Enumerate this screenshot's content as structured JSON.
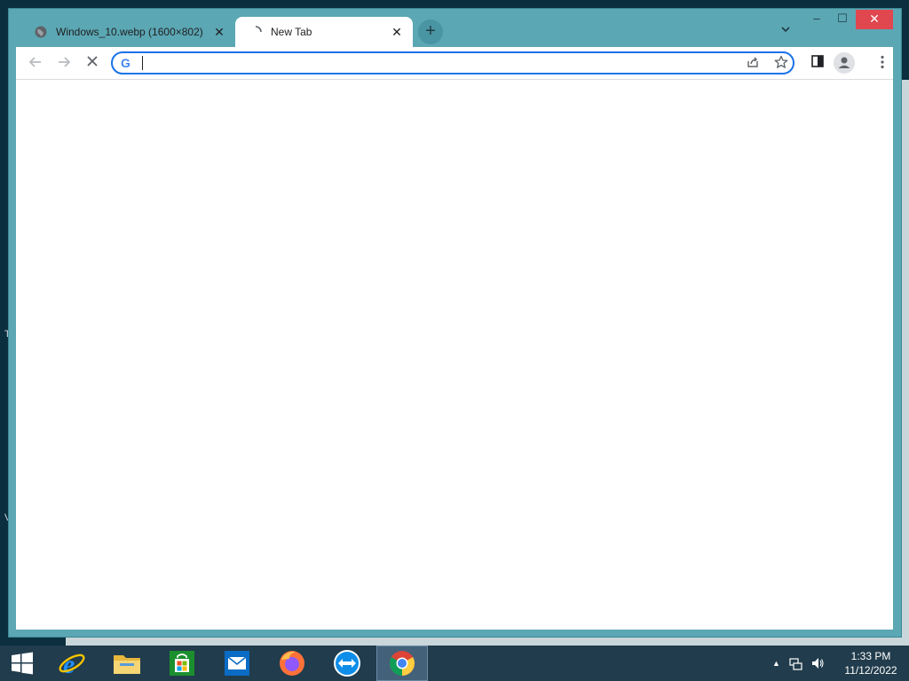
{
  "desktop": {
    "edge_letters": [
      "T",
      "V"
    ]
  },
  "browser": {
    "tabs": [
      {
        "title": "Windows_10.webp (1600×802)",
        "favicon": "globe-icon",
        "active": false
      },
      {
        "title": "New Tab",
        "favicon": "loading-spinner-icon",
        "active": true
      }
    ],
    "new_tab_glyph": "+",
    "tab_search_glyph": "⌄",
    "window_controls": {
      "minimize": "‒",
      "maximize": "☐",
      "close": "✕"
    },
    "toolbar": {
      "back_icon": "arrow-left-icon",
      "forward_icon": "arrow-right-icon",
      "stop_icon": "close-icon",
      "omnibox": {
        "value": "",
        "placeholder": "",
        "search_engine_icon": "google-g-icon"
      },
      "share_icon": "share-icon",
      "bookmark_icon": "star-icon",
      "side_panel_icon": "side-panel-icon",
      "profile_icon": "profile-avatar-icon",
      "menu_icon": "kebab-menu-icon"
    },
    "accent_color": "#1a73e8",
    "frame_color": "#5ba7b4"
  },
  "taskbar": {
    "apps": [
      {
        "name": "start",
        "icon": "windows-logo-icon"
      },
      {
        "name": "internet-explorer",
        "icon": "ie-icon"
      },
      {
        "name": "file-explorer",
        "icon": "folder-icon"
      },
      {
        "name": "store",
        "icon": "store-bag-icon"
      },
      {
        "name": "mail",
        "icon": "mail-icon"
      },
      {
        "name": "firefox",
        "icon": "firefox-icon"
      },
      {
        "name": "teamviewer",
        "icon": "teamviewer-icon"
      },
      {
        "name": "chrome",
        "icon": "chrome-icon",
        "active": true
      }
    ],
    "clock": {
      "time": "1:33 PM",
      "date": "11/12/2022"
    },
    "tray_icons": [
      "chevron-up-icon",
      "network-icon",
      "volume-icon"
    ]
  }
}
